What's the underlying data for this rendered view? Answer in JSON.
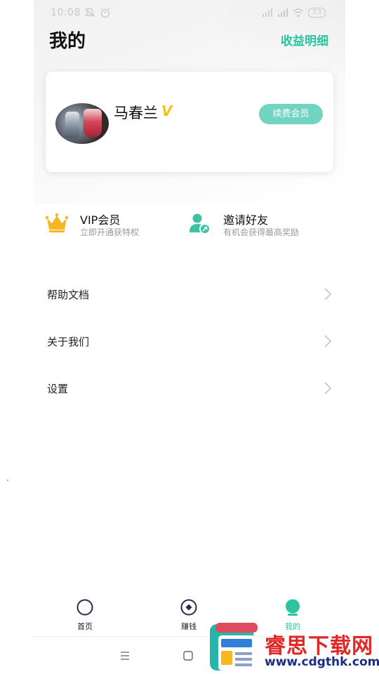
{
  "status_bar": {
    "time": "10:08",
    "battery": "53"
  },
  "header": {
    "title": "我的",
    "income_link": "收益明细"
  },
  "profile": {
    "username": "马春兰",
    "vip_badge": "V",
    "renew_button": "续费会员"
  },
  "features": [
    {
      "title": "VIP会员",
      "subtitle": "立即开通获特权",
      "icon": "crown-icon"
    },
    {
      "title": "邀请好友",
      "subtitle": "有机会获得最高奖励",
      "icon": "invite-user-icon"
    }
  ],
  "menu": [
    {
      "label": "帮助文档"
    },
    {
      "label": "关于我们"
    },
    {
      "label": "设置"
    }
  ],
  "tabs": [
    {
      "label": "首页",
      "icon": "home-circle-icon"
    },
    {
      "label": "赚钱",
      "icon": "earn-diamond-icon"
    },
    {
      "label": "我的",
      "icon": "profile-icon",
      "active": true
    }
  ],
  "watermark": {
    "title": "睿思下载网",
    "url": "www.cdgthk.com"
  },
  "colors": {
    "accent": "#2bc49f",
    "renew_button": "#71d4c0",
    "crown": "#f5b820",
    "vip_badge": "#f2c316",
    "watermark_red": "#e02826",
    "watermark_blue": "#1c2f86"
  }
}
